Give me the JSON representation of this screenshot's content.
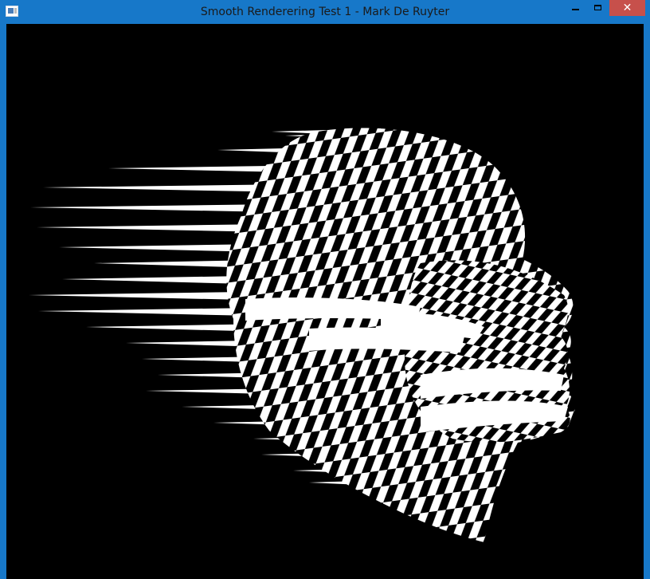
{
  "window": {
    "title": "Smooth Renderering Test 1 - Mark De Ruyter",
    "icon": "app-window-icon",
    "controls": {
      "minimize_icon": "minimize-icon",
      "maximize_icon": "maximize-icon",
      "close_label": "✕"
    }
  },
  "colors": {
    "frame": "#1778c9",
    "close": "#c7504b",
    "viewport_bg": "#000000",
    "mesh": "#ffffff"
  }
}
